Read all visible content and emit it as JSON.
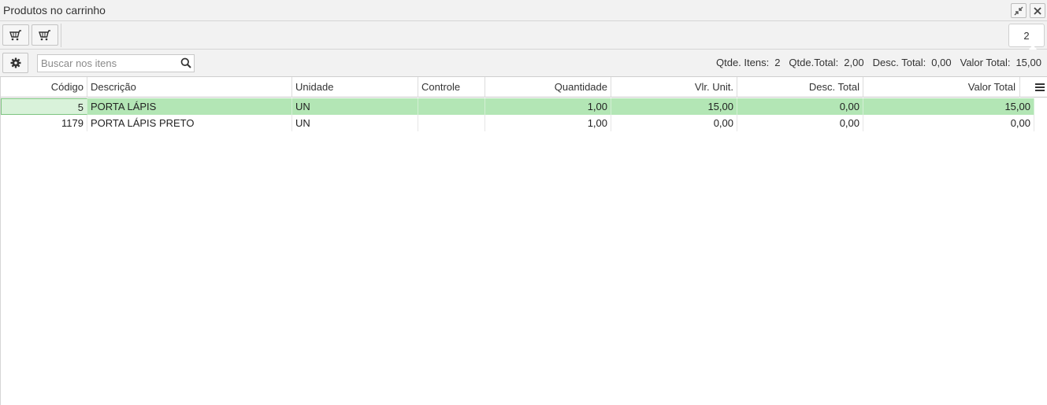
{
  "window": {
    "title": "Produtos no carrinho",
    "minimize_icon": "minimize-icon",
    "close_icon": "close-icon"
  },
  "toolbar": {
    "cart_buttons": [
      "cart-icon",
      "cart-icon"
    ],
    "count": "2"
  },
  "filter": {
    "settings_icon": "gear-icon",
    "search_placeholder": "Buscar nos itens",
    "search_value": "",
    "search_icon": "search-icon"
  },
  "totals": {
    "items_label": "Qtde. Itens:",
    "items_value": "2",
    "qty_label": "Qtde.Total:",
    "qty_value": "2,00",
    "disc_label": "Desc. Total:",
    "disc_value": "0,00",
    "total_label": "Valor Total:",
    "total_value": "15,00"
  },
  "table": {
    "columns": [
      "Código",
      "Descrição",
      "Unidade",
      "Controle",
      "Quantidade",
      "Vlr. Unit.",
      "Desc. Total",
      "Valor Total"
    ],
    "rows": [
      {
        "codigo": "5",
        "descricao": "PORTA LÁPIS",
        "unidade": "UN",
        "controle": "",
        "quantidade": "1,00",
        "vlr_unit": "15,00",
        "desc_total": "0,00",
        "valor_total": "15,00"
      },
      {
        "codigo": "1179",
        "descricao": "PORTA LÁPIS PRETO",
        "unidade": "UN",
        "controle": "",
        "quantidade": "1,00",
        "vlr_unit": "0,00",
        "desc_total": "0,00",
        "valor_total": "0,00"
      }
    ],
    "menu_icon": "menu-icon",
    "selected_row_color": "#b3e6b5"
  }
}
